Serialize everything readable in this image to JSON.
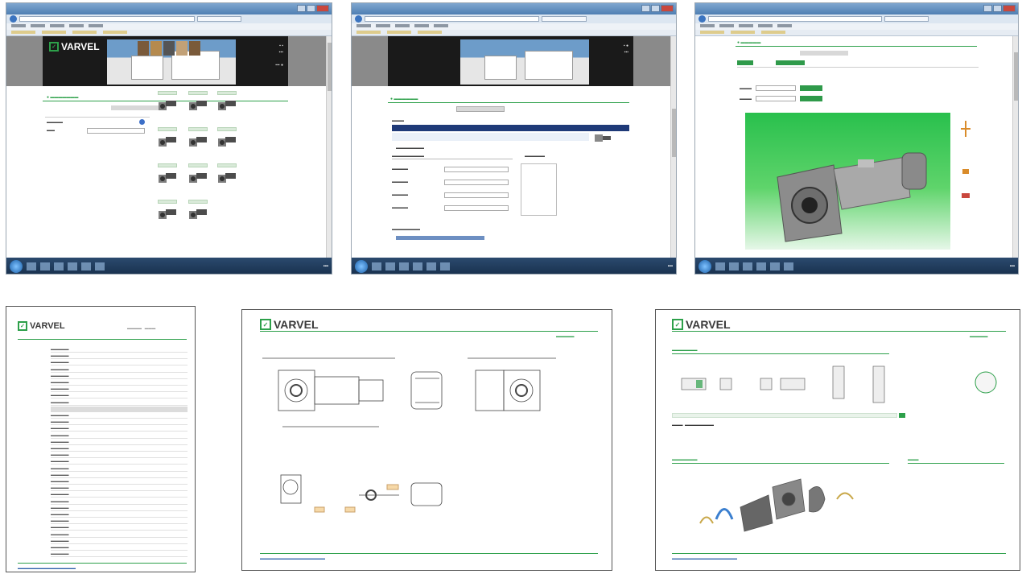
{
  "shot1": {
    "brand": "VARVEL",
    "tab_active": "",
    "sidebar_title": "",
    "product_rows": 5
  },
  "shot2": {
    "brand": "VARVEL",
    "nav_link": "",
    "table_header": ""
  },
  "shot3": {
    "preview": "3D gearmotor preview"
  },
  "doc1": {
    "brand": "VARVEL"
  },
  "doc2": {
    "brand": "VARVEL"
  },
  "doc3": {
    "brand": "VARVEL"
  },
  "colors": {
    "brand_green": "#2da04a",
    "navy": "#1f3a78",
    "render_green": "#29c04d"
  },
  "icons": [
    "window-close-icon",
    "windows-start-icon",
    "gear-motor-icon",
    "check-icon"
  ]
}
